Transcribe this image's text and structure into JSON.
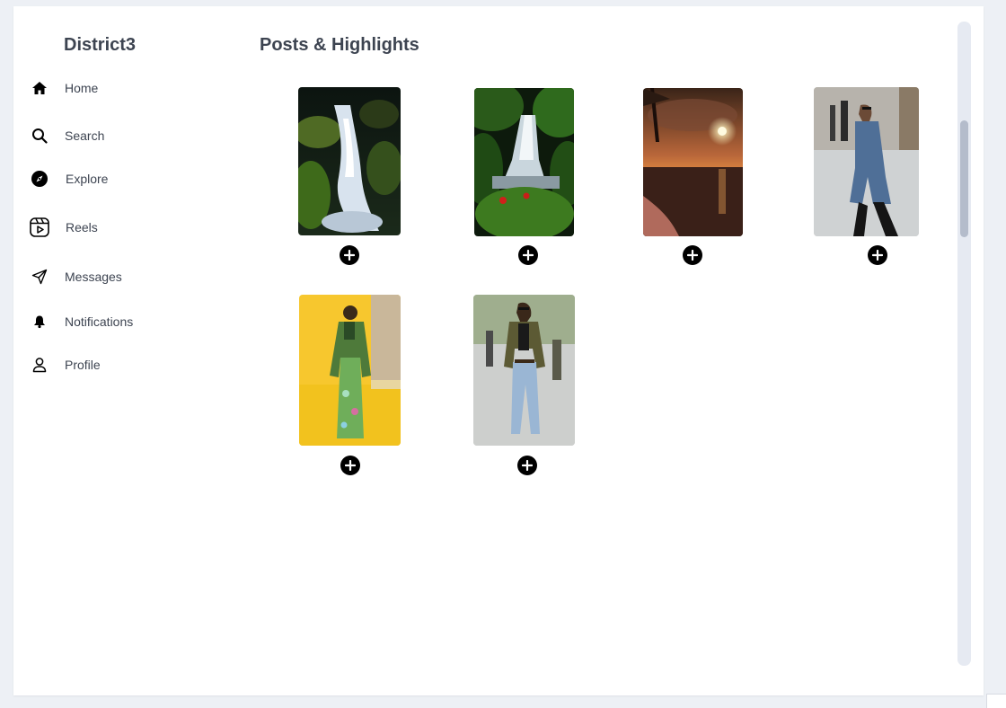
{
  "app": {
    "brand": "District3"
  },
  "sidebar": {
    "items": [
      {
        "label": "Home",
        "icon": "home-icon"
      },
      {
        "label": "Search",
        "icon": "search-icon"
      },
      {
        "label": "Explore",
        "icon": "compass-icon"
      },
      {
        "label": "Reels",
        "icon": "reels-icon"
      },
      {
        "label": "Messages",
        "icon": "paper-plane-icon"
      },
      {
        "label": "Notifications",
        "icon": "bell-icon"
      },
      {
        "label": "Profile",
        "icon": "user-icon"
      }
    ]
  },
  "main": {
    "title": "Posts & Highlights",
    "posts": [
      {
        "subject": "waterfall over mossy rocks"
      },
      {
        "subject": "jungle waterfall with red flowers"
      },
      {
        "subject": "sunset over the sea with palm trees"
      },
      {
        "subject": "man in blue coat walking on street"
      },
      {
        "subject": "runway model in green suit on yellow background"
      },
      {
        "subject": "woman in olive jacket and jeans walking"
      }
    ],
    "add_icon": "plus-circle-icon"
  },
  "colors": {
    "accent": "#3d4451",
    "background": "#edf0f5",
    "card": "#ffffff",
    "scroll_thumb": "#b4bccb"
  }
}
